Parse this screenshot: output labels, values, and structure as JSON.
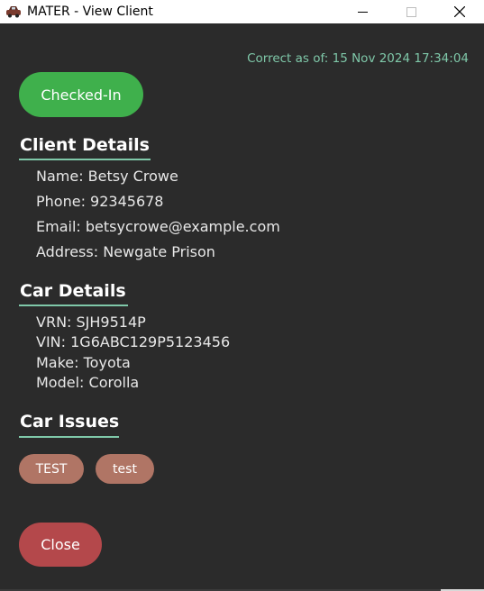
{
  "window": {
    "title": "MATER - View Client",
    "icon": "car-app-icon",
    "controls": [
      "minimize",
      "maximize",
      "close"
    ]
  },
  "timestamp": "Correct as of: 15 Nov 2024 17:34:04",
  "status": {
    "label": "Checked-In",
    "color": "#3fb04c"
  },
  "client": {
    "heading": "Client Details",
    "name": "Name: Betsy Crowe",
    "phone": "Phone: 92345678",
    "email": "Email: betsycrowe@example.com",
    "address": "Address: Newgate Prison"
  },
  "car": {
    "heading": "Car Details",
    "vrn": "VRN: SJH9514P",
    "vin": "VIN: 1G6ABC129P5123456",
    "make": "Make: Toyota",
    "model": "Model: Corolla"
  },
  "issues": {
    "heading": "Car Issues",
    "items": [
      "TEST",
      "test"
    ]
  },
  "actions": {
    "close_label": "Close"
  },
  "colors": {
    "background": "#2b2b2b",
    "accent": "#7fc8a9",
    "issue_tag": "#b07565",
    "close_button": "#b4484b"
  }
}
